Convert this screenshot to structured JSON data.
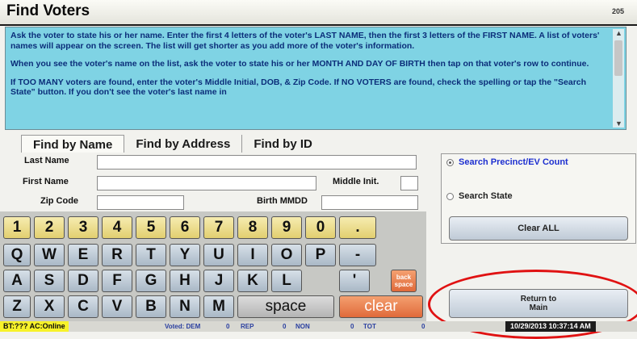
{
  "window": {
    "title": "Find Voters",
    "page_number": "205"
  },
  "instructions": [
    "Ask the voter to state his or her name. Enter the first 4 letters of the voter's LAST NAME, then the first 3 letters of the FIRST NAME. A list of voters' names will appear on the screen.  The list will get shorter as you add more of the voter's information.",
    "When you see the voter's name on the list, ask the voter to state his or her MONTH AND DAY OF BIRTH then tap on that voter's row to continue.",
    "If TOO MANY voters are found, enter the voter's Middle Initial, DOB, & Zip Code.  If NO VOTERS are found, check the spelling or tap the \"Search State\" button. If you don't see the voter's last name in"
  ],
  "tabs": [
    "Find by Name",
    "Find by Address",
    "Find by ID"
  ],
  "form": {
    "last_name_label": "Last Name",
    "first_name_label": "First Name",
    "middle_init_label": "Middle Init.",
    "zip_label": "Zip Code",
    "birth_label": "Birth MMDD",
    "last_name": "",
    "first_name": "",
    "middle_init": "",
    "zip": "",
    "birth": ""
  },
  "keyboard": {
    "row1": [
      "1",
      "2",
      "3",
      "4",
      "5",
      "6",
      "7",
      "8",
      "9",
      "0",
      "."
    ],
    "row2": [
      "Q",
      "W",
      "E",
      "R",
      "T",
      "Y",
      "U",
      "I",
      "O",
      "P",
      "-"
    ],
    "row3": [
      "A",
      "S",
      "D",
      "F",
      "G",
      "H",
      "J",
      "K",
      "L",
      "'"
    ],
    "backspace": "back space",
    "row4": [
      "Z",
      "X",
      "C",
      "V",
      "B",
      "N",
      "M"
    ],
    "space": "space",
    "clear": "clear"
  },
  "search_options": {
    "precinct": "Search  Precinct/EV Count",
    "state": "Search State",
    "selected": "precinct"
  },
  "buttons": {
    "clear_all": "Clear ALL",
    "return_line1": "Return to",
    "return_line2": "Main"
  },
  "status_bar": {
    "bt": "BT:??? AC:Online",
    "voted": "Voted:  DEM",
    "dem": "0",
    "rep_label": "REP",
    "rep": "0",
    "non_label": "NON",
    "non": "0",
    "tot_label": "TOT",
    "tot": "0",
    "datetime": "10/29/2013 10:37:14 AM"
  },
  "colors": {
    "instructions_bg": "#7fd3e4",
    "highlight_ring": "#e01212",
    "status_yellow": "#f7f22a"
  }
}
